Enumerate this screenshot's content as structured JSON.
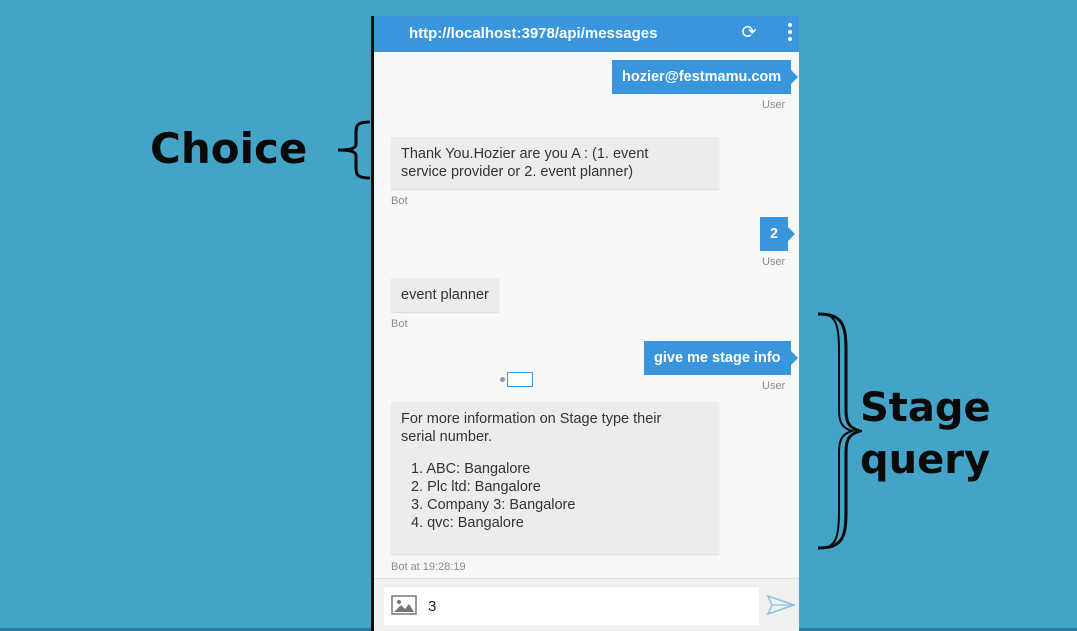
{
  "annotations": {
    "choice": "Choice",
    "stage_line1": "Stage",
    "stage_line2": "query"
  },
  "window": {
    "url": "http://localhost:3978/api/messages",
    "icons": [
      "refresh-icon",
      "more-vertical-icon"
    ]
  },
  "messages": [
    {
      "from": "user",
      "text": "hozier@festmamu.com",
      "meta": "User"
    },
    {
      "from": "bot",
      "line1": "Thank You.Hozier are you A : (1. event",
      "line2": "service provider or 2. event planner)",
      "meta": "Bot"
    },
    {
      "from": "user",
      "text": "2",
      "meta": "User"
    },
    {
      "from": "bot",
      "text": "event planner",
      "meta": "Bot"
    },
    {
      "from": "user",
      "text": "give me stage info",
      "meta": "User"
    },
    {
      "from": "bot",
      "line1": "For more information on Stage type their",
      "line2": "serial number.",
      "items": [
        "1. ABC: Bangalore",
        "2. Plc ltd: Bangalore",
        "3. Company 3: Bangalore",
        "4. qvc: Bangalore"
      ],
      "meta": "Bot at 19:28:19"
    }
  ],
  "composer": {
    "value": "3",
    "icons": [
      "image-icon",
      "send-icon"
    ]
  },
  "colors": {
    "background": "#44a4c8",
    "accent": "#3a96dc",
    "bot_bubble": "#ececec"
  }
}
